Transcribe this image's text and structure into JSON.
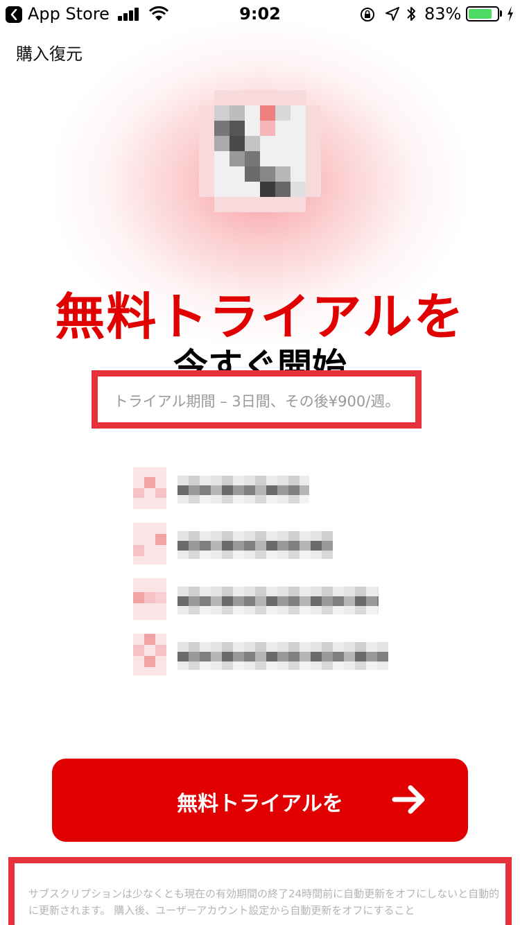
{
  "status_bar": {
    "back_app": "App Store",
    "time": "9:02",
    "battery_percent": "83%",
    "battery_level": 0.83,
    "battery_color": "#4cd964"
  },
  "header": {
    "restore_label": "購入復元"
  },
  "hero": {
    "icon": "blurred-app-icon",
    "glow_color": "#f0505a"
  },
  "headline": "無料トライアルを",
  "subheadline": "今すぐ開始",
  "trial_info": "トライアル期間 – 3日間、その後¥900/週。",
  "features": [
    {
      "icon": "blurred-feature-icon",
      "text_blurred": true
    },
    {
      "icon": "blurred-feature-icon",
      "text_blurred": true
    },
    {
      "icon": "blurred-feature-icon",
      "text_blurred": true
    },
    {
      "icon": "blurred-feature-icon",
      "text_blurred": true
    }
  ],
  "cta": {
    "label": "無料トライアルを",
    "icon": "arrow-right-icon",
    "color": "#e00000"
  },
  "legal": "サブスクリプションは少なくとも現在の有効期間の終了24時間前に自動更新をオフにしないと自動的に更新されます。 購入後、ユーザーアカウント設定から自動更新をオフにすること",
  "highlight_color": "#e8323b"
}
